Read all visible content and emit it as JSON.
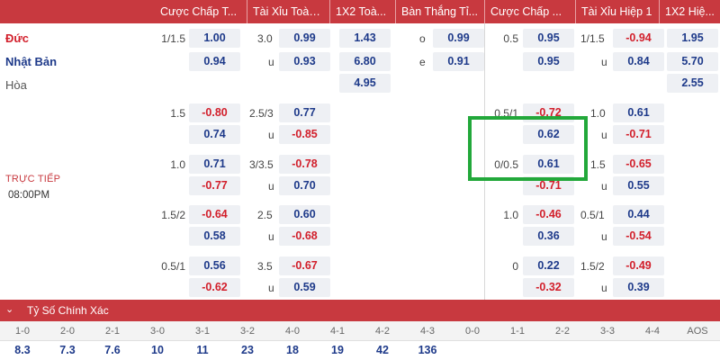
{
  "header": {
    "columns": [
      "Cược Chấp T...",
      "Tài Xỉu Toàn ...",
      "1X2 Toà...",
      "Bàn Thắng Tỉ...",
      "Cược Chấp ...",
      "Tài Xỉu Hiệp 1",
      "1X2 Hiệ..."
    ]
  },
  "match": {
    "home": "Đức",
    "away": "Nhật Bản",
    "draw": "Hòa",
    "status": "TRỰC TIẾP",
    "time": "08:00PM"
  },
  "ft_handicap": [
    {
      "hcap": "1/1.5",
      "odds": [
        "1.00",
        "0.94"
      ]
    },
    {
      "hcap": "1.5",
      "odds": [
        "-0.80",
        "0.74"
      ]
    },
    {
      "hcap": "1.0",
      "odds": [
        "0.71",
        "-0.77"
      ]
    },
    {
      "hcap": "1.5/2",
      "odds": [
        "-0.64",
        "0.58"
      ]
    },
    {
      "hcap": "0.5/1",
      "odds": [
        "0.56",
        "-0.62"
      ]
    }
  ],
  "ft_over_under": [
    {
      "line": "3.0",
      "under_label": "u",
      "odds": [
        "0.99",
        "0.93"
      ]
    },
    {
      "line": "2.5/3",
      "under_label": "u",
      "odds": [
        "0.77",
        "-0.85"
      ]
    },
    {
      "line": "3/3.5",
      "under_label": "u",
      "odds": [
        "-0.78",
        "0.70"
      ]
    },
    {
      "line": "2.5",
      "under_label": "u",
      "odds": [
        "0.60",
        "-0.68"
      ]
    },
    {
      "line": "3.5",
      "under_label": "u",
      "odds": [
        "-0.67",
        "0.59"
      ]
    }
  ],
  "ft_1x2": [
    "1.43",
    "6.80",
    "4.95"
  ],
  "odd_even": {
    "labels": [
      "o",
      "e"
    ],
    "odds": [
      "0.99",
      "0.91"
    ]
  },
  "h1_handicap": [
    {
      "hcap": "0.5",
      "odds": [
        "0.95",
        "0.95"
      ]
    },
    {
      "hcap": "0.5/1",
      "odds": [
        "-0.72",
        "0.62"
      ]
    },
    {
      "hcap": "0/0.5",
      "odds": [
        "0.61",
        "-0.71"
      ]
    },
    {
      "hcap": "1.0",
      "odds": [
        "-0.46",
        "0.36"
      ]
    },
    {
      "hcap": "0",
      "odds": [
        "0.22",
        "-0.32"
      ]
    }
  ],
  "h1_over_under": [
    {
      "line": "1/1.5",
      "under_label": "u",
      "odds": [
        "-0.94",
        "0.84"
      ]
    },
    {
      "line": "1.0",
      "under_label": "u",
      "odds": [
        "0.61",
        "-0.71"
      ]
    },
    {
      "line": "1.5",
      "under_label": "u",
      "odds": [
        "-0.65",
        "0.55"
      ]
    },
    {
      "line": "0.5/1",
      "under_label": "u",
      "odds": [
        "0.44",
        "-0.54"
      ]
    },
    {
      "line": "1.5/2",
      "under_label": "u",
      "odds": [
        "-0.49",
        "0.39"
      ]
    }
  ],
  "h1_1x2": [
    "1.95",
    "5.70",
    "2.55"
  ],
  "correct_score": {
    "title": "Tỷ Số Chính Xác",
    "scores": [
      "1-0",
      "2-0",
      "2-1",
      "3-0",
      "3-1",
      "3-2",
      "4-0",
      "4-1",
      "4-2",
      "4-3",
      "0-0",
      "1-1",
      "2-2",
      "3-3",
      "4-4",
      "AOS"
    ],
    "odds": [
      "8.3",
      "7.3",
      "7.6",
      "10",
      "11",
      "23",
      "18",
      "19",
      "42",
      "136",
      "",
      "",
      "",
      "",
      "",
      ""
    ]
  },
  "colors": {
    "header_bg": "#c8393f",
    "positive_odds": "#1e3a8a",
    "negative_odds": "#d21f2b",
    "highlight_border": "#22a83a"
  }
}
